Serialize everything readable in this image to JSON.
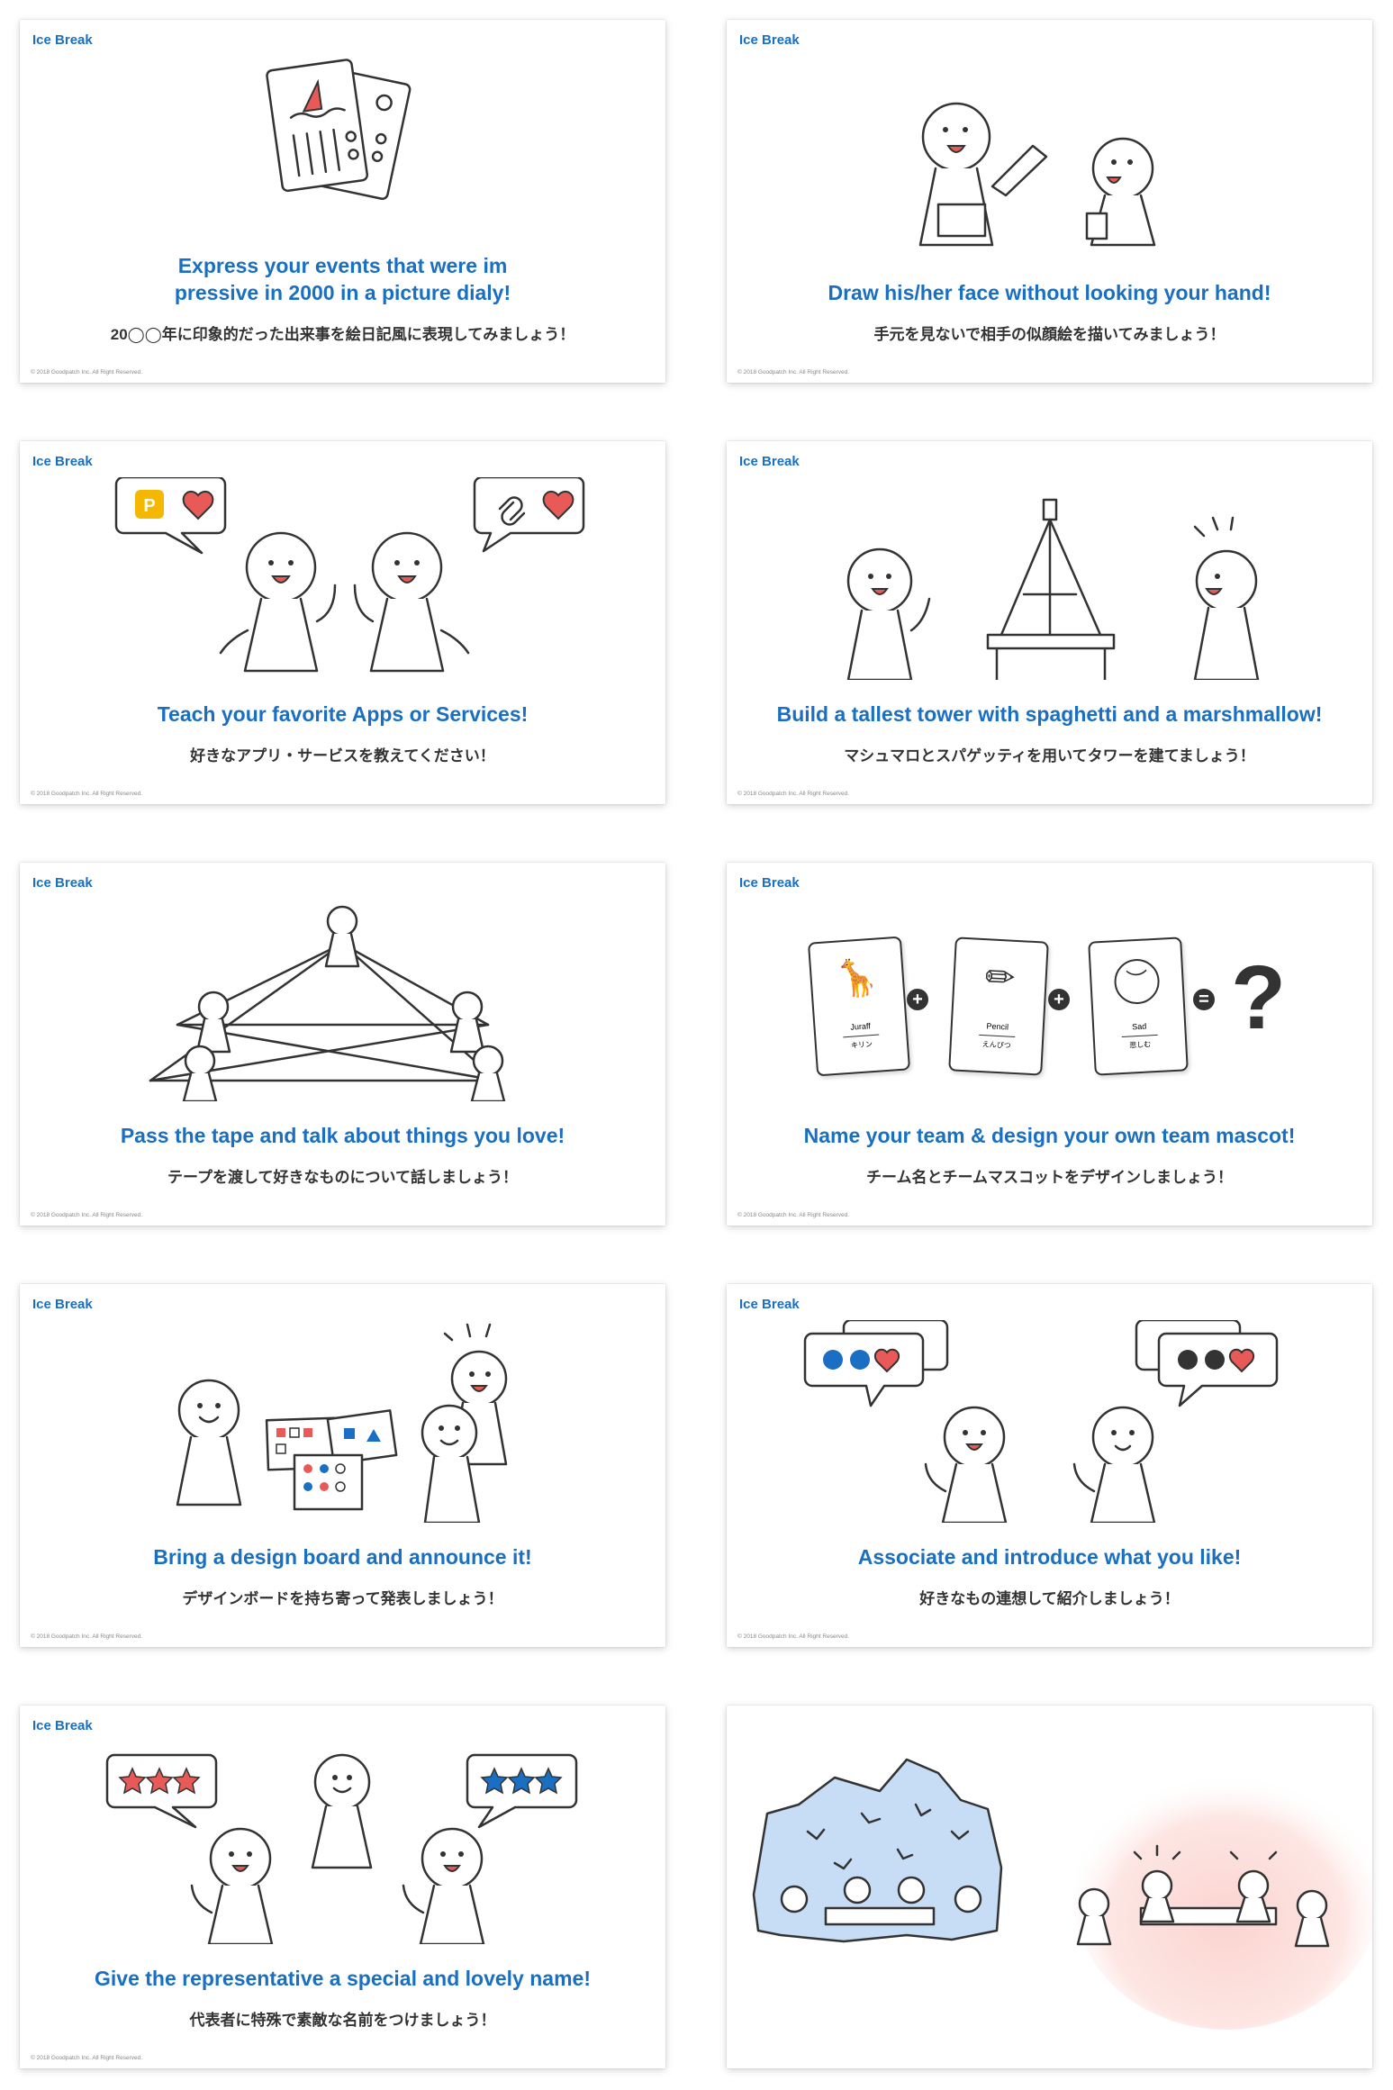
{
  "cards": [
    {
      "tag": "Ice Break",
      "title": "Express your events that were im pressive in 2000 in  a picture dialy!",
      "subtitle": "20◯◯年に印象的だった出来事を絵日記風に表現してみましょう！",
      "copyright": "© 2018 Goodpatch Inc. All Right Reserved."
    },
    {
      "tag": "Ice Break",
      "title": "Draw his/her face without looking your hand!",
      "subtitle": "手元を見ないで相手の似顔絵を描いてみましょう！",
      "copyright": "© 2018 Goodpatch Inc. All Right Reserved."
    },
    {
      "tag": "Ice Break",
      "title": "Teach your favorite Apps or Services!",
      "subtitle": "好きなアプリ・サービスを教えてください！",
      "copyright": "© 2018 Goodpatch Inc. All Right Reserved."
    },
    {
      "tag": "Ice Break",
      "title": "Build a tallest tower with spaghetti and a marshmallow!",
      "subtitle": "マシュマロとスパゲッティを用いてタワーを建てましょう！",
      "copyright": "© 2018 Goodpatch Inc. All Right Reserved."
    },
    {
      "tag": "Ice Break",
      "title": "Pass the tape and talk about things you love!",
      "subtitle": "テープを渡して好きなものについて話しましょう！",
      "copyright": "© 2018 Goodpatch Inc. All Right Reserved."
    },
    {
      "tag": "Ice Break",
      "title": "Name your team & design your own team mascot!",
      "subtitle": "チーム名とチームマスコットをデザインしましょう！",
      "copyright": "© 2018 Goodpatch Inc. All Right Reserved.",
      "cards": [
        {
          "en": "Juraff",
          "jp": "キリン"
        },
        {
          "en": "Pencil",
          "jp": "えんぴつ"
        },
        {
          "en": "Sad",
          "jp": "悲しむ"
        }
      ],
      "symbols": {
        "plus": "+",
        "equals": "=",
        "question": "?"
      }
    },
    {
      "tag": "Ice Break",
      "title": "Bring a design board and announce it!",
      "subtitle": "デザインボードを持ち寄って発表しましょう！",
      "copyright": "© 2018 Goodpatch Inc. All Right Reserved."
    },
    {
      "tag": "Ice Break",
      "title": "Associate and introduce what you like!",
      "subtitle": "好きなもの連想して紹介しましょう！",
      "copyright": "© 2018 Goodpatch Inc. All Right Reserved."
    },
    {
      "tag": "Ice Break",
      "title": "Give the representative a special and lovely name!",
      "subtitle": "代表者に特殊で素敵な名前をつけましょう！",
      "copyright": "© 2018 Goodpatch Inc. All Right Reserved."
    }
  ],
  "colors": {
    "accent": "#1a6fc2",
    "red": "#e85a58",
    "ice": "#c7dcf5",
    "warm": "#fde3e1"
  },
  "icons": [
    "app-p-icon",
    "link-icon",
    "heart-icon",
    "star-icon",
    "question-mark-icon"
  ]
}
